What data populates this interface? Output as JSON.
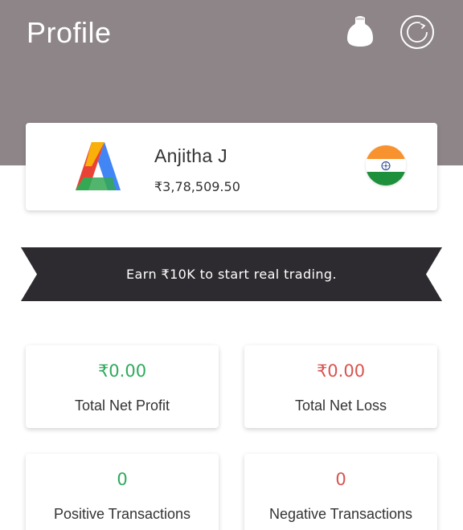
{
  "header": {
    "title": "Profile",
    "icons": [
      "bulb-icon",
      "history-icon"
    ],
    "background": "#8e8589"
  },
  "profile": {
    "name": "Anjitha J",
    "balance": "₹3,78,509.50",
    "avatar_letter": "A",
    "flag": "india-flag"
  },
  "banner": {
    "text": "Earn ₹10K to start real trading.",
    "background": "#2e2b30"
  },
  "stats": [
    {
      "value": "₹0.00",
      "label": "Total Net Profit",
      "color": "#2eaa5b"
    },
    {
      "value": "₹0.00",
      "label": "Total Net Loss",
      "color": "#d9534f"
    },
    {
      "value": "0",
      "label": "Positive Transactions",
      "color": "#2eaa5b"
    },
    {
      "value": "0",
      "label": "Negative Transactions",
      "color": "#d9534f"
    }
  ]
}
